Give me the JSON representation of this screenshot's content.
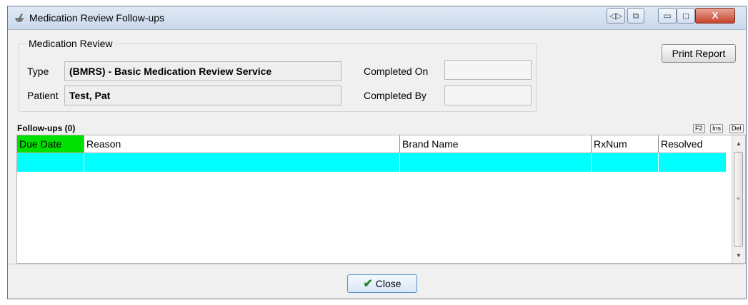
{
  "window": {
    "title": "Medication Review Follow-ups"
  },
  "title_buttons": {
    "back": "◁▷",
    "restore_alt": "⧉",
    "minimize": "▭",
    "maximize": "◻",
    "close": "X"
  },
  "review": {
    "legend": "Medication Review",
    "type_label": "Type",
    "type_value": "(BMRS) - Basic Medication Review Service",
    "patient_label": "Patient",
    "patient_value": "Test, Pat",
    "completed_on_label": "Completed On",
    "completed_on_value": "",
    "completed_by_label": "Completed By",
    "completed_by_value": ""
  },
  "print_report": "Print Report",
  "followups": {
    "label": "Follow-ups (0)",
    "keys": [
      "F2",
      "Ins",
      "Del"
    ],
    "columns": [
      "Due Date",
      "Reason",
      "Brand Name",
      "RxNum",
      "Resolved"
    ],
    "rows": [
      [
        "",
        "",
        "",
        "",
        ""
      ]
    ]
  },
  "close_label": "Close",
  "colors": {
    "sorted_header": "#00e000",
    "selected_row": "#00ffff"
  }
}
